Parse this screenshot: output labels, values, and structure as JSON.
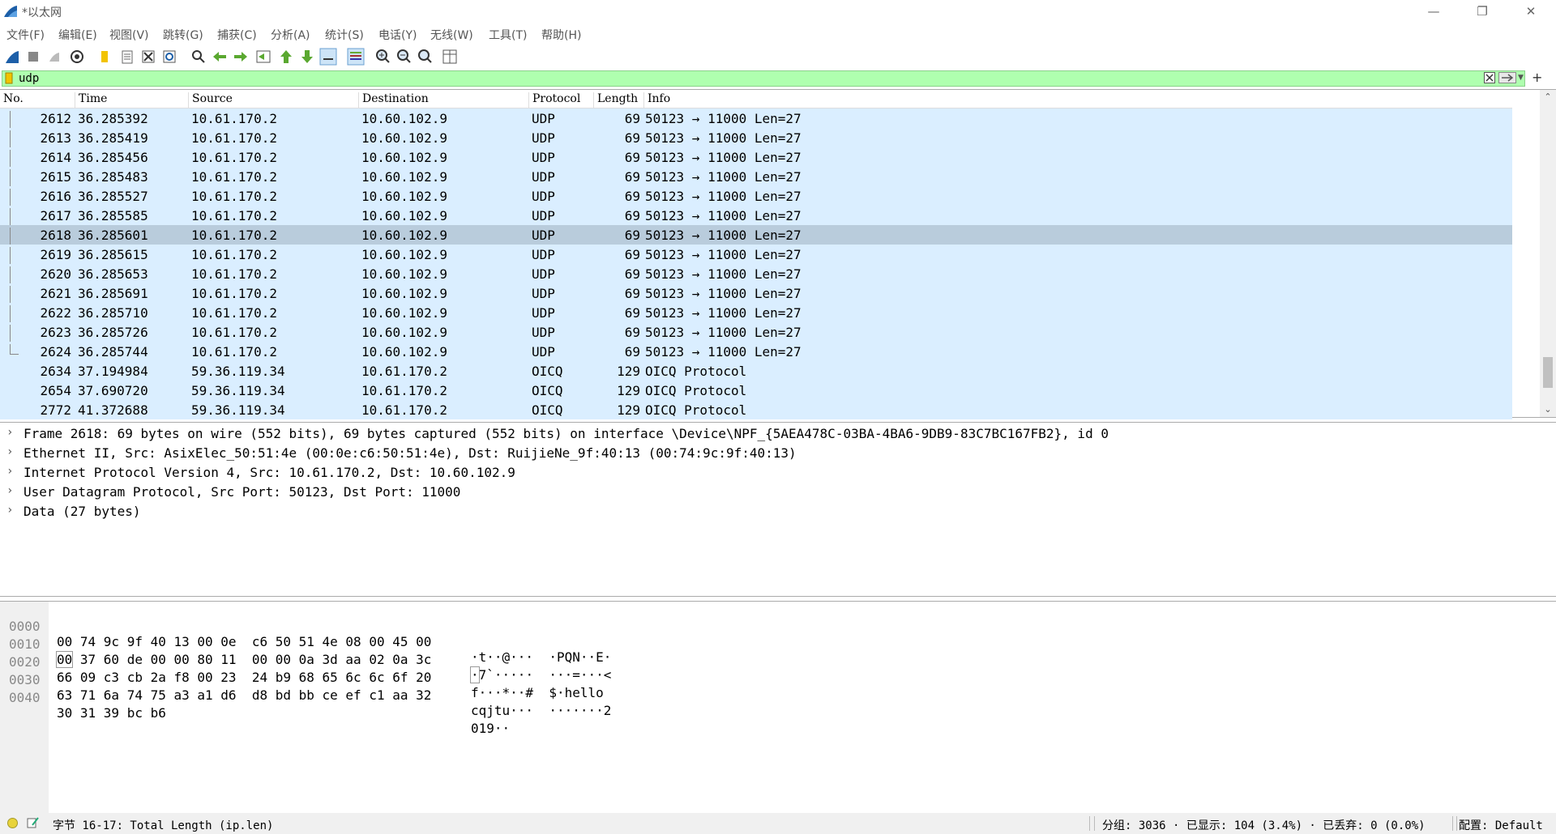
{
  "window": {
    "title": "*以太网",
    "minimize": "—",
    "restore": "❐",
    "close": "✕"
  },
  "menu": [
    "文件(F)",
    "编辑(E)",
    "视图(V)",
    "跳转(G)",
    "捕获(C)",
    "分析(A)",
    "统计(S)",
    "电话(Y)",
    "无线(W)",
    "工具(T)",
    "帮助(H)"
  ],
  "toolbar_icons": [
    "shark-fin-start-icon",
    "stop-capture-icon",
    "restart-capture-icon",
    "capture-options-icon",
    "open-file-icon",
    "save-file-icon",
    "close-file-icon",
    "reload-file-icon",
    "find-packet-icon",
    "go-back-icon",
    "go-forward-icon",
    "go-to-packet-icon",
    "first-packet-icon",
    "last-packet-icon",
    "autoscroll-icon",
    "colorize-icon",
    "zoom-in-icon",
    "zoom-out-icon",
    "normal-size-icon",
    "resize-columns-icon"
  ],
  "filter": {
    "value": "udp"
  },
  "packet_list": {
    "columns": [
      "No.",
      "Time",
      "Source",
      "Destination",
      "Protocol",
      "Length",
      "Info"
    ],
    "rows": [
      {
        "no": "2612",
        "time": "36.285392",
        "src": "10.61.170.2",
        "dst": "10.60.102.9",
        "proto": "UDP",
        "len": "69",
        "info": "50123 → 11000 Len=27"
      },
      {
        "no": "2613",
        "time": "36.285419",
        "src": "10.61.170.2",
        "dst": "10.60.102.9",
        "proto": "UDP",
        "len": "69",
        "info": "50123 → 11000 Len=27"
      },
      {
        "no": "2614",
        "time": "36.285456",
        "src": "10.61.170.2",
        "dst": "10.60.102.9",
        "proto": "UDP",
        "len": "69",
        "info": "50123 → 11000 Len=27"
      },
      {
        "no": "2615",
        "time": "36.285483",
        "src": "10.61.170.2",
        "dst": "10.60.102.9",
        "proto": "UDP",
        "len": "69",
        "info": "50123 → 11000 Len=27"
      },
      {
        "no": "2616",
        "time": "36.285527",
        "src": "10.61.170.2",
        "dst": "10.60.102.9",
        "proto": "UDP",
        "len": "69",
        "info": "50123 → 11000 Len=27"
      },
      {
        "no": "2617",
        "time": "36.285585",
        "src": "10.61.170.2",
        "dst": "10.60.102.9",
        "proto": "UDP",
        "len": "69",
        "info": "50123 → 11000 Len=27"
      },
      {
        "no": "2618",
        "time": "36.285601",
        "src": "10.61.170.2",
        "dst": "10.60.102.9",
        "proto": "UDP",
        "len": "69",
        "info": "50123 → 11000 Len=27"
      },
      {
        "no": "2619",
        "time": "36.285615",
        "src": "10.61.170.2",
        "dst": "10.60.102.9",
        "proto": "UDP",
        "len": "69",
        "info": "50123 → 11000 Len=27"
      },
      {
        "no": "2620",
        "time": "36.285653",
        "src": "10.61.170.2",
        "dst": "10.60.102.9",
        "proto": "UDP",
        "len": "69",
        "info": "50123 → 11000 Len=27"
      },
      {
        "no": "2621",
        "time": "36.285691",
        "src": "10.61.170.2",
        "dst": "10.60.102.9",
        "proto": "UDP",
        "len": "69",
        "info": "50123 → 11000 Len=27"
      },
      {
        "no": "2622",
        "time": "36.285710",
        "src": "10.61.170.2",
        "dst": "10.60.102.9",
        "proto": "UDP",
        "len": "69",
        "info": "50123 → 11000 Len=27"
      },
      {
        "no": "2623",
        "time": "36.285726",
        "src": "10.61.170.2",
        "dst": "10.60.102.9",
        "proto": "UDP",
        "len": "69",
        "info": "50123 → 11000 Len=27"
      },
      {
        "no": "2624",
        "time": "36.285744",
        "src": "10.61.170.2",
        "dst": "10.60.102.9",
        "proto": "UDP",
        "len": "69",
        "info": "50123 → 11000 Len=27"
      },
      {
        "no": "2634",
        "time": "37.194984",
        "src": "59.36.119.34",
        "dst": "10.61.170.2",
        "proto": "OICQ",
        "len": "129",
        "info": "OICQ Protocol"
      },
      {
        "no": "2654",
        "time": "37.690720",
        "src": "59.36.119.34",
        "dst": "10.61.170.2",
        "proto": "OICQ",
        "len": "129",
        "info": "OICQ Protocol"
      },
      {
        "no": "2772",
        "time": "41.372688",
        "src": "59.36.119.34",
        "dst": "10.61.170.2",
        "proto": "OICQ",
        "len": "129",
        "info": "OICQ Protocol"
      }
    ],
    "selected_no": "2618"
  },
  "details": [
    "Frame 2618: 69 bytes on wire (552 bits), 69 bytes captured (552 bits) on interface \\Device\\NPF_{5AEA478C-03BA-4BA6-9DB9-83C7BC167FB2}, id 0",
    "Ethernet II, Src: AsixElec_50:51:4e (00:0e:c6:50:51:4e), Dst: RuijieNe_9f:40:13 (00:74:9c:9f:40:13)",
    "Internet Protocol Version 4, Src: 10.61.170.2, Dst: 10.60.102.9",
    "User Datagram Protocol, Src Port: 50123, Dst Port: 11000",
    "Data (27 bytes)"
  ],
  "bytes": [
    {
      "offset": "0000",
      "hex": "00 74 9c 9f 40 13 00 0e  c6 50 51 4e 08 00 45 00",
      "ascii": "·t··@···  ·PQN··E·"
    },
    {
      "offset": "0010",
      "hex_first": "00",
      "hex": " 37 60 de 00 00 80 11  00 00 0a 3d aa 02 0a 3c",
      "ascii_first": "·",
      "ascii": "7`·····  ···=···<"
    },
    {
      "offset": "0020",
      "hex": "66 09 c3 cb 2a f8 00 23  24 b9 68 65 6c 6c 6f 20",
      "ascii": "f···*··#  $·hello "
    },
    {
      "offset": "0030",
      "hex": "63 71 6a 74 75 a3 a1 d6  d8 bd bb ce ef c1 aa 32",
      "ascii": "cqjtu···  ·······2"
    },
    {
      "offset": "0040",
      "hex": "30 31 39 bc b6",
      "ascii": "019··"
    }
  ],
  "status": {
    "field": "字节 16-17: Total Length (ip.len)",
    "packets": "分组: 3036 · 已显示: 104 (3.4%) · 已丢弃: 0 (0.0%)",
    "profile": "配置: Default"
  },
  "colors": {
    "filter_valid": "#afffaf",
    "row_udp": "#daeeff",
    "row_selected": "#b9ccdc"
  }
}
